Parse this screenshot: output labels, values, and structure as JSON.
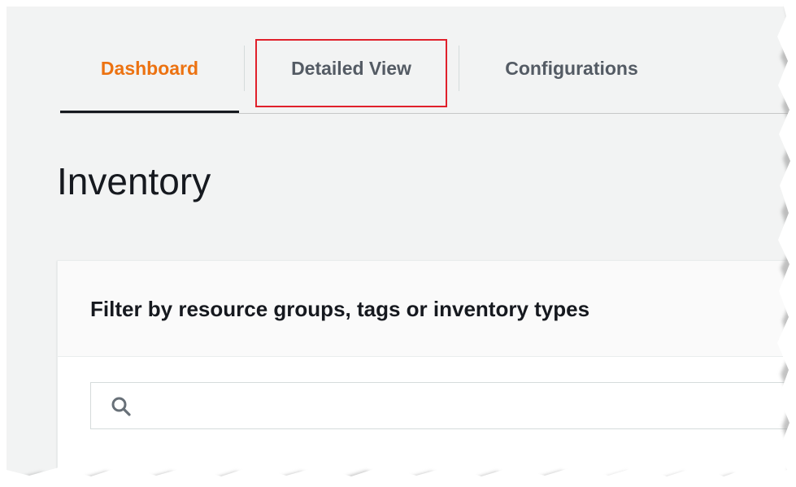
{
  "tabs": {
    "items": [
      {
        "label": "Dashboard",
        "active": true
      },
      {
        "label": "Detailed View",
        "active": false,
        "highlighted": true
      },
      {
        "label": "Configurations",
        "active": false
      }
    ]
  },
  "page": {
    "title": "Inventory"
  },
  "filter_panel": {
    "title": "Filter by resource groups, tags or inventory types",
    "search": {
      "value": "",
      "placeholder": "",
      "icon": "search-icon"
    }
  },
  "colors": {
    "accent_active_tab": "#ec7211",
    "highlight_box": "#e0202b",
    "background": "#f2f3f3",
    "text_dark": "#16191f",
    "text_muted": "#545b64"
  }
}
